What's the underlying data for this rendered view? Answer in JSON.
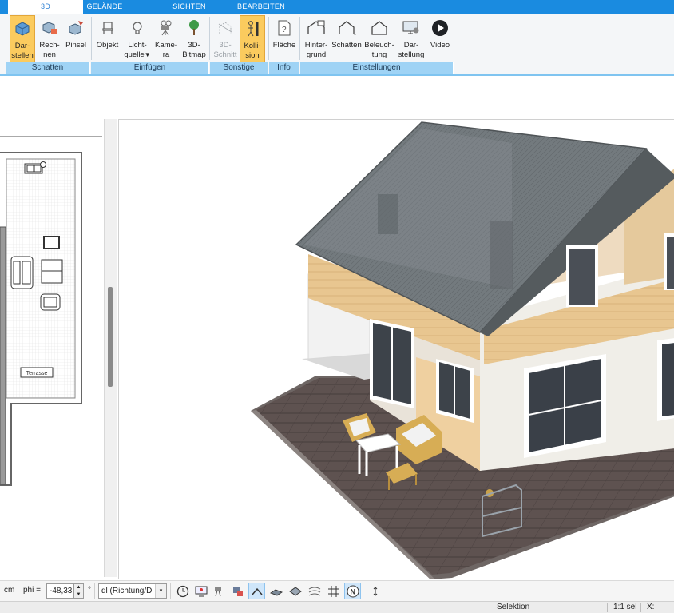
{
  "tabs": [
    {
      "label": "3D",
      "active": true
    },
    {
      "label": "GELÄNDE",
      "active": false
    },
    {
      "label": "SICHTEN",
      "active": false
    },
    {
      "label": "BEARBEITEN",
      "active": false
    }
  ],
  "ribbon": {
    "buttons": [
      {
        "label": "Dar-\nstellen",
        "icon": "render-cube-icon",
        "active": true
      },
      {
        "label": "Rech-\nnen",
        "icon": "calc-cube-icon"
      },
      {
        "label": "Pinsel",
        "icon": "brush-cube-icon"
      },
      {
        "label": "Objekt",
        "icon": "chair-icon"
      },
      {
        "label": "Licht-\nquelle",
        "icon": "lightbulb-icon",
        "dropdown": "▼"
      },
      {
        "label": "Kame-\nra",
        "icon": "camera-icon"
      },
      {
        "label": "3D-\nBitmap",
        "icon": "tree-icon"
      },
      {
        "label": "3D-\nSchnitt",
        "icon": "section-icon",
        "disabled": true
      },
      {
        "label": "Kolli-\nsion",
        "icon": "collision-person-icon",
        "active": true
      },
      {
        "label": "Fläche",
        "icon": "area-info-icon"
      },
      {
        "label": "Hinter-\ngrund",
        "icon": "house-background-icon"
      },
      {
        "label": "Schatten",
        "icon": "house-shadow-icon"
      },
      {
        "label": "Beleuch-\ntung",
        "icon": "house-light-icon"
      },
      {
        "label": "Dar-\nstellung",
        "icon": "monitor-gear-icon"
      },
      {
        "label": "Video",
        "icon": "play-icon"
      }
    ],
    "groups": [
      "Schatten",
      "Einfügen",
      "Sonstige",
      "Info",
      "Einstellungen"
    ]
  },
  "plan": {
    "room_label": "Terrasse"
  },
  "toolbar": {
    "unit": "cm",
    "phi_label": "phi =",
    "phi_value": "-48,33",
    "degree": "°",
    "direction_select": "dl (Richtung/Di"
  },
  "status": {
    "mode": "Selektion",
    "scale": "1:1 sel",
    "coord_label": "X:"
  },
  "colors": {
    "tab_bar": "#1a8be0",
    "active_button": "#fbcb5e",
    "group_label_bg": "#9fd3f5",
    "roof": "#6f7578",
    "facade_wood": "#e8c48e",
    "terrace": "#5e5250"
  }
}
